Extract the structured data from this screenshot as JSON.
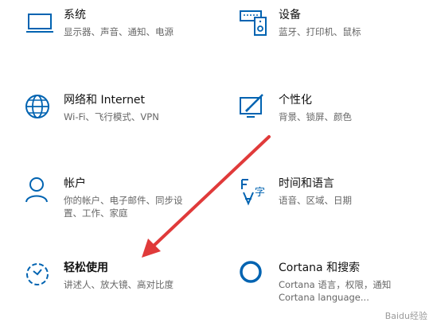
{
  "tiles": [
    {
      "id": "system",
      "title": "系统",
      "subtitle": "显示器、声音、通知、电源",
      "icon": "laptop-icon"
    },
    {
      "id": "devices",
      "title": "设备",
      "subtitle": "蓝牙、打印机、鼠标",
      "icon": "keyboard-device-icon"
    },
    {
      "id": "network",
      "title": "网络和 Internet",
      "subtitle": "Wi-Fi、飞行模式、VPN",
      "icon": "globe-icon"
    },
    {
      "id": "personalization",
      "title": "个性化",
      "subtitle": "背景、锁屏、颜色",
      "icon": "paint-brush-icon"
    },
    {
      "id": "accounts",
      "title": "帐户",
      "subtitle": "你的帐户、电子邮件、同步设置、工作、家庭",
      "subtitle_line1": "你的帐户、电子邮件、同步设",
      "subtitle_line2": "置、工作、家庭",
      "icon": "person-icon"
    },
    {
      "id": "time-language",
      "title": "时间和语言",
      "subtitle": "语音、区域、日期",
      "icon": "language-clock-icon"
    },
    {
      "id": "ease-of-access",
      "title": "轻松使用",
      "subtitle": "讲述人、放大镜、高对比度",
      "icon": "ease-of-access-icon"
    },
    {
      "id": "cortana",
      "title": "Cortana 和搜索",
      "subtitle_line1": "Cortana 语言，权限，通知",
      "subtitle_line2": "Cortana language...",
      "icon": "cortana-icon"
    }
  ],
  "colors": {
    "accent": "#0063b1",
    "arrow": "#e03a3a",
    "title": "#111111",
    "subtitle": "#666666"
  },
  "watermark": "Baidu经验"
}
